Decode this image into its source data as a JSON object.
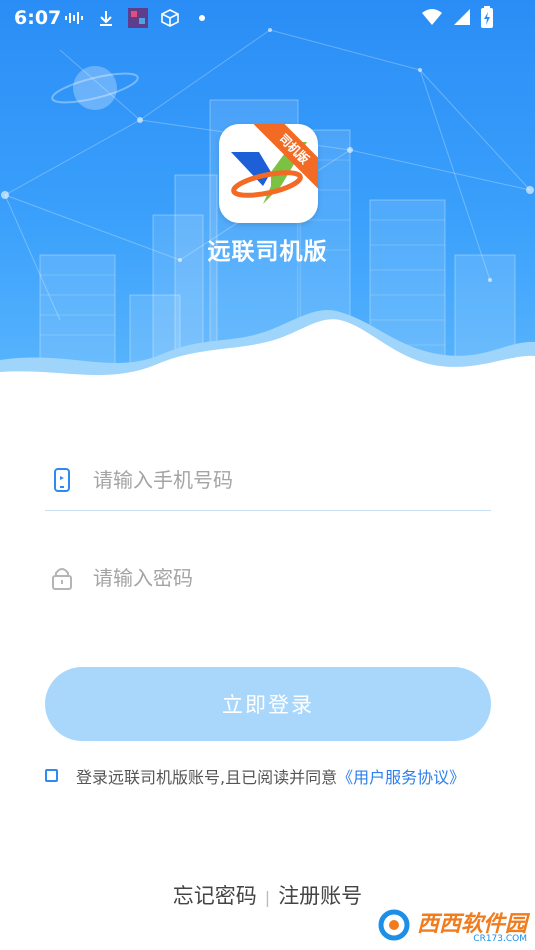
{
  "status_bar": {
    "time": "6:07",
    "left_icons": [
      "audio-wave-icon",
      "download-icon",
      "app-thumbnail-icon",
      "cube-icon",
      "dot-icon"
    ],
    "right_icons": [
      "wifi-icon",
      "signal-icon",
      "battery-icon"
    ]
  },
  "header": {
    "app_name": "远联司机版",
    "logo_badge": "司机版"
  },
  "form": {
    "phone_placeholder": "请输入手机号码",
    "password_placeholder": "请输入密码",
    "login_label": "立即登录"
  },
  "agreement": {
    "text": "登录远联司机版账号,且已阅读并同意",
    "link": "《用户服务协议》"
  },
  "footer": {
    "forgot_password": "忘记密码",
    "separator": "|",
    "register": "注册账号"
  },
  "watermark": {
    "brand": "西西软件园",
    "url": "CR173.COM"
  },
  "colors": {
    "hero_blue": "#2a8df6",
    "button_disabled": "#a8d7fb",
    "link_blue": "#2c7ff0",
    "logo_orange": "#f36a25"
  }
}
